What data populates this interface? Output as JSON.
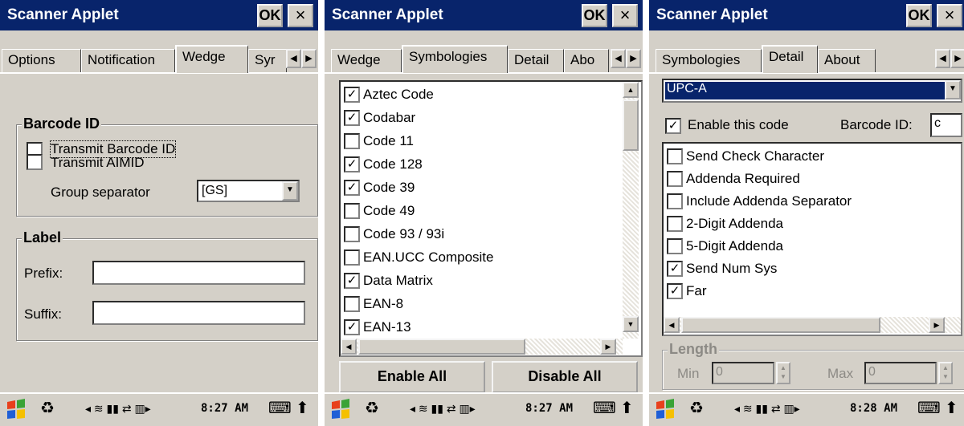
{
  "app_title": "Scanner Applet",
  "ok_label": "OK",
  "close_label": "×",
  "panels": {
    "wedge": {
      "tabs": [
        "Options",
        "Notification",
        "Wedge",
        "Syr"
      ],
      "barcode_group": "Barcode ID",
      "transmit_barcode_id": "Transmit Barcode ID",
      "transmit_aimid": "Transmit AIMID",
      "group_separator_label": "Group separator",
      "group_separator_value": "[GS]",
      "label_group": "Label",
      "prefix_label": "Prefix:",
      "suffix_label": "Suffix:",
      "prefix_value": "",
      "suffix_value": "",
      "time": "8:27 AM"
    },
    "symbologies": {
      "tabs": [
        "Wedge",
        "Symbologies",
        "Detail",
        "Abo"
      ],
      "items": [
        {
          "label": "Aztec Code",
          "checked": true
        },
        {
          "label": "Codabar",
          "checked": true
        },
        {
          "label": "Code 11",
          "checked": false
        },
        {
          "label": "Code 128",
          "checked": true
        },
        {
          "label": "Code 39",
          "checked": true
        },
        {
          "label": "Code 49",
          "checked": false
        },
        {
          "label": "Code 93 / 93i",
          "checked": false
        },
        {
          "label": "EAN.UCC Composite",
          "checked": false
        },
        {
          "label": "Data Matrix",
          "checked": true
        },
        {
          "label": "EAN-8",
          "checked": false
        },
        {
          "label": "EAN-13",
          "checked": true
        }
      ],
      "enable_all": "Enable All",
      "disable_all": "Disable All",
      "time": "8:27 AM"
    },
    "detail": {
      "tabs": [
        "Symbologies",
        "Detail",
        "About"
      ],
      "symbology_select": "UPC-A",
      "enable_this_code": "Enable this code",
      "enable_checked": true,
      "barcode_id_label": "Barcode ID:",
      "barcode_id_value": "c",
      "options": [
        {
          "label": "Send Check Character",
          "checked": false
        },
        {
          "label": "Addenda Required",
          "checked": false
        },
        {
          "label": "Include Addenda Separator",
          "checked": false
        },
        {
          "label": "2-Digit Addenda",
          "checked": false
        },
        {
          "label": "5-Digit Addenda",
          "checked": false
        },
        {
          "label": "Send Num Sys",
          "checked": true
        },
        {
          "label": "Far",
          "checked": true
        }
      ],
      "length_group": "Length",
      "min_label": "Min",
      "min_value": "0",
      "max_label": "Max",
      "max_value": "0",
      "time": "8:28 AM"
    }
  },
  "colors": {
    "title_bar": "#08246b",
    "face": "#d4d0c8",
    "selection": "#08246b"
  }
}
